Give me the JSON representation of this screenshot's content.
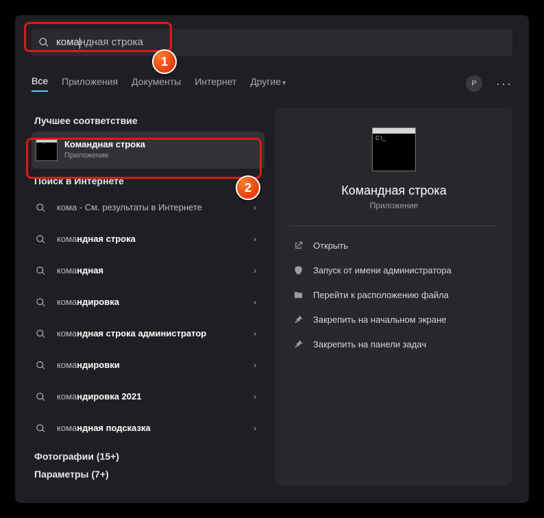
{
  "search": {
    "typed": "кома",
    "suggested_tail": "ндная строка"
  },
  "tabs": {
    "all": "Все",
    "apps": "Приложения",
    "docs": "Документы",
    "web": "Интернет",
    "more": "Другие"
  },
  "avatar_initial": "P",
  "sections": {
    "best": "Лучшее соответствие",
    "web": "Поиск в Интернете",
    "photos": "Фотографии (15+)",
    "settings": "Параметры (7+)"
  },
  "best_match": {
    "title": "Командная строка",
    "subtitle": "Приложение"
  },
  "web_results": [
    {
      "prefix": "кома",
      "bold": "",
      "suffix": " - См. результаты в Интернете"
    },
    {
      "prefix": "кома",
      "bold": "ндная строка",
      "suffix": ""
    },
    {
      "prefix": "кома",
      "bold": "ндная",
      "suffix": ""
    },
    {
      "prefix": "кома",
      "bold": "ндировка",
      "suffix": ""
    },
    {
      "prefix": "кома",
      "bold": "ндная строка администратор",
      "suffix": ""
    },
    {
      "prefix": "кома",
      "bold": "ндировки",
      "suffix": ""
    },
    {
      "prefix": "кома",
      "bold": "ндировка 2021",
      "suffix": ""
    },
    {
      "prefix": "кома",
      "bold": "ндная подсказка",
      "suffix": ""
    }
  ],
  "preview": {
    "title": "Командная строка",
    "subtitle": "Приложение"
  },
  "actions": {
    "open": "Открыть",
    "admin": "Запуск от имени администратора",
    "location": "Перейти к расположению файла",
    "pin_start": "Закрепить на начальном экране",
    "pin_taskbar": "Закрепить на панели задач"
  },
  "annotations": {
    "badge1": "1",
    "badge2": "2"
  }
}
